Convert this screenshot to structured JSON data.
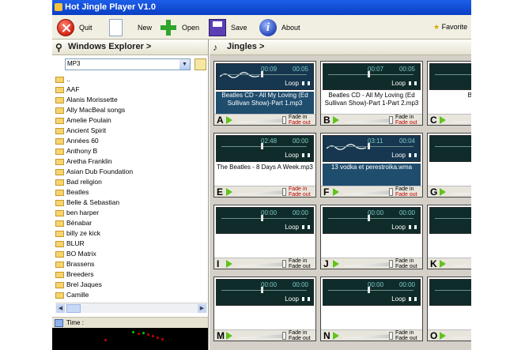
{
  "window": {
    "title": "Hot Jingle Player V1.0"
  },
  "toolbar": {
    "quit": "Quit",
    "new": "New",
    "open": "Open",
    "save": "Save",
    "about": "About",
    "favorite": "Favorite"
  },
  "explorer": {
    "title": "Windows Explorer >",
    "combo_value": "MP3",
    "items": [
      "..",
      "AAF",
      "Alanis Morissette",
      "Ally MacBeal songs",
      "Amelie Poulain",
      "Ancient Spirit",
      "Années 60",
      "Anthony B",
      "Aretha Franklin",
      "Asian Dub Foundation",
      "Bad religion",
      "Beatles",
      "Belle & Sebastian",
      "ben harper",
      "Bénabar",
      "billy ze kick",
      "BLUR",
      "BO Matrix",
      "Brassens",
      "Breeders",
      "Brel Jaques",
      "Camille"
    ],
    "time_label": "Time :"
  },
  "jingles": {
    "title": "Jingles >",
    "loop_label": "Loop",
    "fade_in": "Fade in",
    "fade_out": "Fade out",
    "cards": [
      {
        "letter": "A",
        "t1": "00:09",
        "t2": "00:05",
        "title": "Beatles CD - All My Loving (Ed Sullivan Show)-Part 1.mp3",
        "selected": true,
        "wave": true,
        "knob": 0.45,
        "fin": false,
        "fout": true
      },
      {
        "letter": "B",
        "t1": "00:07",
        "t2": "00:05",
        "title": "Beatles CD - All My Loving (Ed Sullivan Show)-Part 1-Part 2.mp3",
        "selected": false,
        "wave": false,
        "knob": 0.45,
        "fin": false,
        "fout": true
      },
      {
        "letter": "C",
        "t1": "",
        "t2": "",
        "title": "Beatles",
        "selected": false,
        "wave": false,
        "knob": 0.45,
        "fin": false,
        "fout": true
      },
      {
        "letter": "E",
        "t1": "02:48",
        "t2": "00:00",
        "title": "The Beatles - 8 Days A Week.mp3",
        "selected": false,
        "wave": false,
        "knob": 0.45,
        "fin": true,
        "fout": true
      },
      {
        "letter": "F",
        "t1": "03:11",
        "t2": "00:04",
        "title": "13 vodka et perestroika.wma",
        "selected": true,
        "wave": true,
        "knob": 0.45,
        "fin": false,
        "fout": true
      },
      {
        "letter": "G",
        "t1": "",
        "t2": "",
        "title": "",
        "selected": false,
        "wave": false,
        "knob": 0.45,
        "fin": false,
        "fout": false
      },
      {
        "letter": "I",
        "t1": "00:00",
        "t2": "00:00",
        "title": "",
        "selected": false,
        "wave": false,
        "knob": 0.45,
        "fin": false,
        "fout": false
      },
      {
        "letter": "J",
        "t1": "00:00",
        "t2": "00:00",
        "title": "",
        "selected": false,
        "wave": false,
        "knob": 0.45,
        "fin": false,
        "fout": false
      },
      {
        "letter": "K",
        "t1": "",
        "t2": "",
        "title": "",
        "selected": false,
        "wave": false,
        "knob": 0.45,
        "fin": false,
        "fout": false
      },
      {
        "letter": "M",
        "t1": "00:00",
        "t2": "00:00",
        "title": "",
        "selected": false,
        "wave": false,
        "knob": 0.45,
        "fin": false,
        "fout": false
      },
      {
        "letter": "N",
        "t1": "00:00",
        "t2": "00:00",
        "title": "",
        "selected": false,
        "wave": false,
        "knob": 0.45,
        "fin": false,
        "fout": false
      },
      {
        "letter": "O",
        "t1": "",
        "t2": "",
        "title": "",
        "selected": false,
        "wave": false,
        "knob": 0.45,
        "fin": false,
        "fout": false
      }
    ]
  }
}
